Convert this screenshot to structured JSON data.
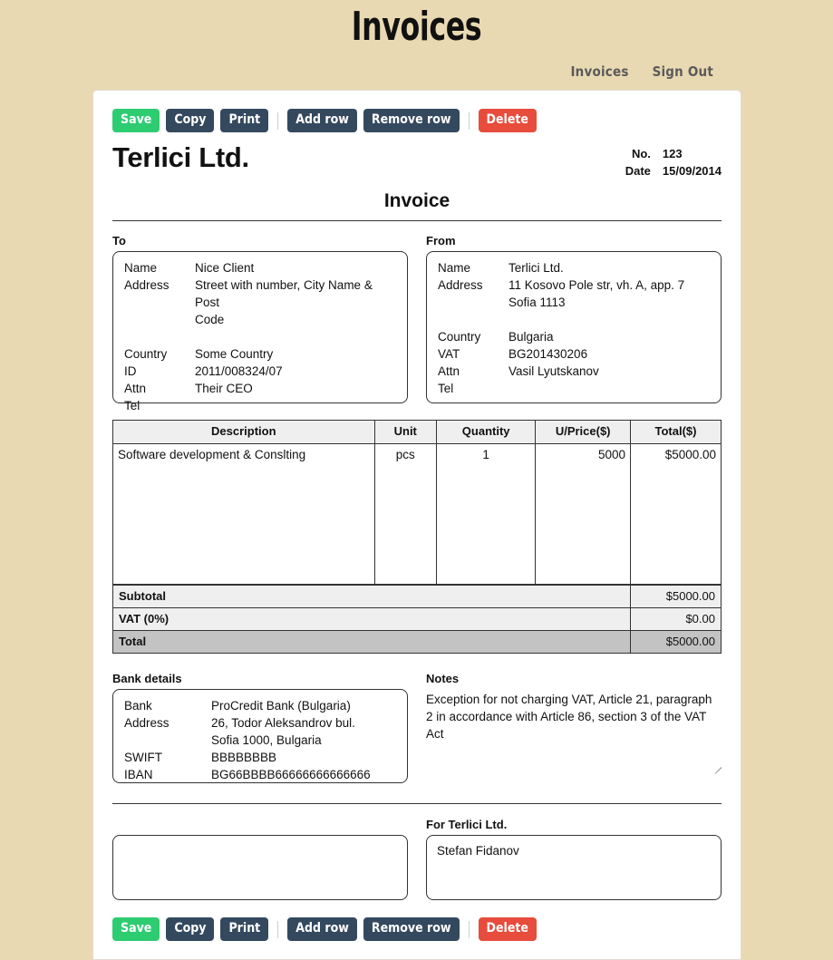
{
  "header": {
    "title": "Invoices",
    "nav": [
      {
        "label": "Invoices",
        "name": "nav-link-invoices"
      },
      {
        "label": "Sign Out",
        "name": "nav-link-sign-out"
      }
    ]
  },
  "toolbar": {
    "save_label": "Save",
    "copy_label": "Copy",
    "print_label": "Print",
    "add_row_label": "Add row",
    "remove_row_label": "Remove row",
    "delete_label": "Delete"
  },
  "invoice": {
    "company_name": "Terlici Ltd.",
    "no_label": "No.",
    "no_value": "123",
    "date_label": "Date",
    "date_value": "15/09/2014",
    "doc_title": "Invoice"
  },
  "to": {
    "section_label": "To",
    "name_label": "Name",
    "name_value": "Nice Client",
    "address_label": "Address",
    "address_line1": "Street with number, City Name & Post",
    "address_line2": "Code",
    "country_label": "Country",
    "country_value": "Some Country",
    "id_label": "ID",
    "id_value": "2011/008324/07",
    "attn_label": "Attn",
    "attn_value": "Their CEO",
    "tel_label": "Tel",
    "tel_value": ""
  },
  "from": {
    "section_label": "From",
    "name_label": "Name",
    "name_value": "Terlici Ltd.",
    "address_label": "Address",
    "address_line1": "11 Kosovo Pole str, vh. A, app. 7",
    "address_line2": "Sofia 1113",
    "country_label": "Country",
    "country_value": "Bulgaria",
    "vat_label": "VAT",
    "vat_value": "BG201430206",
    "attn_label": "Attn",
    "attn_value": "Vasil Lyutskanov",
    "tel_label": "Tel",
    "tel_value": ""
  },
  "items_table": {
    "columns": [
      "Description",
      "Unit",
      "Quantity",
      "U/Price($)",
      "Total($)"
    ],
    "rows": [
      {
        "description": "Software development & Conslting",
        "unit": "pcs",
        "quantity": "1",
        "unit_price": "5000",
        "total": "$5000.00"
      }
    ]
  },
  "totals": {
    "subtotal_label": "Subtotal",
    "subtotal_value": "$5000.00",
    "vat_label": "VAT (0%)",
    "vat_value": "$0.00",
    "total_label": "Total",
    "total_value": "$5000.00"
  },
  "bank": {
    "section_label": "Bank details",
    "bank_label": "Bank",
    "bank_value": "ProCredit Bank (Bulgaria)",
    "address_label": "Address",
    "address_line1": "26, Todor Aleksandrov bul.",
    "address_line2": "Sofia 1000, Bulgaria",
    "swift_label": "SWIFT",
    "swift_value": "BBBBBBBB",
    "iban_label": "IBAN",
    "iban_value": "BG66BBBB66666666666666"
  },
  "notes": {
    "section_label": "Notes",
    "text": "Exception for not charging VAT, Article 21, paragraph 2 in accordance with Article 86, section 3 of the VAT Act"
  },
  "signature": {
    "left_value": "",
    "right_label": "For Terlici Ltd.",
    "right_value": "Stefan Fidanov"
  },
  "colors": {
    "page_background": "#e9d9b3",
    "panel": "#ffffff",
    "button_default": "#34495e",
    "button_success": "#2ecc71",
    "button_danger": "#e74c3c",
    "table_header": "#efefef",
    "total_row": "#c3c3c3"
  }
}
